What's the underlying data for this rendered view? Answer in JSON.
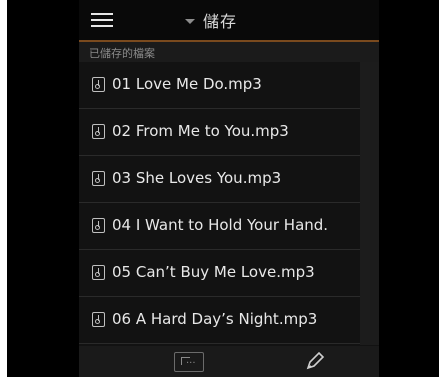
{
  "header": {
    "title": "儲存"
  },
  "section": {
    "label": "已儲存的檔案"
  },
  "files": [
    {
      "name": "01 Love Me Do.mp3"
    },
    {
      "name": "02 From Me to You.mp3"
    },
    {
      "name": "03 She Loves You.mp3"
    },
    {
      "name": "04 I Want to Hold Your Hand."
    },
    {
      "name": "05 Can’t Buy Me Love.mp3"
    },
    {
      "name": "06 A Hard Day’s Night.mp3"
    }
  ],
  "colors": {
    "accent": "#7a4a1e",
    "background": "#121212"
  },
  "icons": {
    "menu": "hamburger-menu-icon",
    "file": "music-file-icon",
    "upload": "upload-folder-icon",
    "edit": "pencil-icon"
  }
}
